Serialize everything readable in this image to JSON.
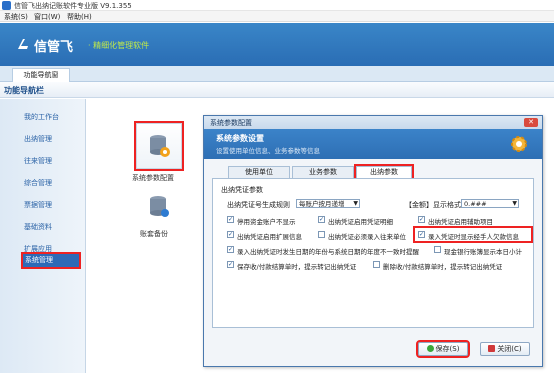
{
  "window": {
    "title": "信管飞出纳记账软件专业版 V9.1.355"
  },
  "menu": [
    {
      "label": "系统(S)"
    },
    {
      "label": "窗口(W)"
    },
    {
      "label": "帮助(H)"
    }
  ],
  "banner": {
    "brand": "信管飞",
    "slogan": "· 精细化管理软件"
  },
  "tabs": {
    "nav_tab": "功能导航窗"
  },
  "nav": {
    "header": "功能导航栏",
    "items": [
      {
        "label": "我的工作台"
      },
      {
        "label": "出纳管理"
      },
      {
        "label": "往来管理"
      },
      {
        "label": "综合管理"
      },
      {
        "label": "票据管理"
      },
      {
        "label": "基础资料"
      },
      {
        "label": "扩展应用"
      },
      {
        "label": "系统管理"
      }
    ],
    "active": "系统管理"
  },
  "tiles": [
    {
      "label": "系统参数配置"
    },
    {
      "label": "账套备份"
    }
  ],
  "dialog": {
    "title": "系统参数配置",
    "header_title": "系统参数设置",
    "header_sub": "设置使用单位信息、业务参数等信息",
    "tabs": [
      {
        "label": "使用单位"
      },
      {
        "label": "业务参数"
      },
      {
        "label": "出纳参数"
      }
    ],
    "active_tab": "出纳参数",
    "section": "出纳凭证参数",
    "rule_label": "出纳凭证号生成规则",
    "rule_value": "每账户按月递增",
    "amount_label": "【金额】显示格式",
    "amount_value": "0.###",
    "options": [
      {
        "label": "停用资金账户不显示",
        "checked": true
      },
      {
        "label": "出纳凭证启用凭证明细",
        "checked": true
      },
      {
        "label": "出纳凭证启用辅助项目",
        "checked": true
      },
      {
        "label": "出纳凭证启用扩展信息",
        "checked": true
      },
      {
        "label": "出纳凭证必须录入往来单位",
        "checked": false
      },
      {
        "label": "录入凭证时显示经手人欠款信息",
        "checked": true
      },
      {
        "label": "录入出纳凭证时发生日期的年份与系统日期的年度不一致时提醒",
        "checked": true
      },
      {
        "label": "现金银行账簿显示本日小计",
        "checked": false
      },
      {
        "label": "保存收/付款结算单时，提示转记出纳凭证",
        "checked": true
      },
      {
        "label": "删除收/付款结算单时，提示转记出纳凭证",
        "checked": false
      }
    ],
    "save_label": "保存(S)",
    "close_label": "关闭(C)"
  }
}
